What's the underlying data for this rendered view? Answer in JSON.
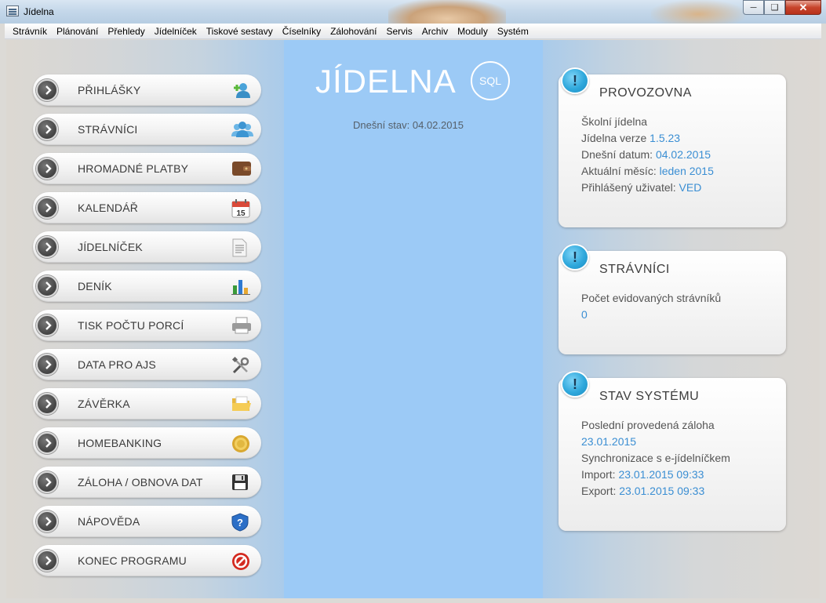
{
  "window": {
    "title": "Jídelna"
  },
  "menu": [
    "Strávník",
    "Plánování",
    "Přehledy",
    "Jídelníček",
    "Tiskové sestavy",
    "Číselníky",
    "Zálohování",
    "Servis",
    "Archiv",
    "Moduly",
    "Systém"
  ],
  "nav": [
    {
      "label": "PŘIHLÁŠKY",
      "icon": "add-user-icon"
    },
    {
      "label": "STRÁVNÍCI",
      "icon": "users-icon"
    },
    {
      "label": "HROMADNÉ PLATBY",
      "icon": "wallet-icon"
    },
    {
      "label": "KALENDÁŘ",
      "icon": "calendar-icon"
    },
    {
      "label": "JÍDELNÍČEK",
      "icon": "document-icon"
    },
    {
      "label": "DENÍK",
      "icon": "bar-chart-icon"
    },
    {
      "label": "TISK POČTU PORCÍ",
      "icon": "printer-icon"
    },
    {
      "label": "DATA PRO AJS",
      "icon": "tools-icon"
    },
    {
      "label": "ZÁVĚRKA",
      "icon": "folder-icon"
    },
    {
      "label": "HOMEBANKING",
      "icon": "coin-icon"
    },
    {
      "label": "ZÁLOHA / OBNOVA DAT",
      "icon": "floppy-icon"
    },
    {
      "label": "NÁPOVĚDA",
      "icon": "help-shield-icon"
    },
    {
      "label": "KONEC PROGRAMU",
      "icon": "stop-icon"
    }
  ],
  "center": {
    "logo": "JÍDELNA",
    "logo_badge": "SQL",
    "today_label": "Dnešní stav: 04.02.2015"
  },
  "cards": {
    "provozovna": {
      "title": "PROVOZOVNA",
      "name": "Školní jídelna",
      "version_label": "Jídelna verze",
      "version": "1.5.23",
      "date_label": "Dnešní datum:",
      "date": "04.02.2015",
      "month_label": "Aktuální měsíc:",
      "month": "leden 2015",
      "user_label": "Přihlášený uživatel:",
      "user": "VED"
    },
    "stravnici": {
      "title": "STRÁVNÍCI",
      "count_label": "Počet evidovaných strávníků",
      "count": "0"
    },
    "system": {
      "title": "STAV SYSTÉMU",
      "backup_label": "Poslední provedená záloha",
      "backup": "23.01.2015",
      "sync_label": "Synchronizace s e-jídelníčkem",
      "import_label": "Import:",
      "import": "23.01.2015 09:33",
      "export_label": "Export:",
      "export": "23.01.2015 09:33"
    }
  },
  "badge_glyph": "!",
  "colors": {
    "center_panel": "#9ccaf6",
    "value_text": "#3a8ed3",
    "badge": "#2fa8dc"
  }
}
